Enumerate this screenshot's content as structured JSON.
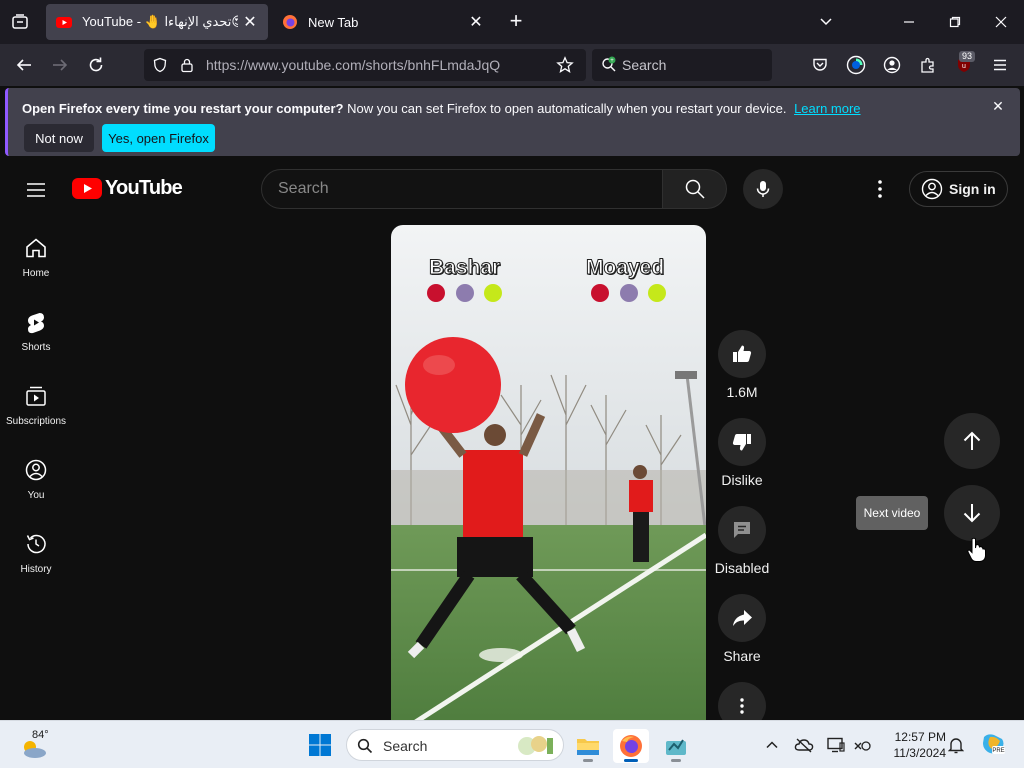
{
  "browser": {
    "tabs": [
      {
        "title": "YouTube - 🤚 تحدي الإنهاءا😍",
        "active": true
      },
      {
        "title": "New Tab",
        "active": false
      }
    ],
    "url": "https://www.youtube.com/shorts/bnhFLmdaJqQ",
    "search_placeholder": "Search",
    "extension_badge": "93"
  },
  "notification": {
    "title": "Open Firefox every time you restart your computer?",
    "body": "Now you can set Firefox to open automatically when you restart your device.",
    "link": "Learn more",
    "not_now": "Not now",
    "yes": "Yes, open Firefox"
  },
  "youtube": {
    "logo_text": "YouTube",
    "search_placeholder": "Search",
    "signin": "Sign in",
    "sidebar": [
      {
        "label": "Home",
        "icon": "home-icon"
      },
      {
        "label": "Shorts",
        "icon": "shorts-icon"
      },
      {
        "label": "Subscriptions",
        "icon": "subscriptions-icon"
      },
      {
        "label": "You",
        "icon": "you-icon"
      },
      {
        "label": "History",
        "icon": "history-icon"
      }
    ],
    "short": {
      "player1": "Bashar",
      "player2": "Moayed"
    },
    "actions": {
      "likes": "1.6M",
      "dislike": "Dislike",
      "comments": "Disabled",
      "share": "Share"
    },
    "tooltip": "Next video"
  },
  "taskbar": {
    "temperature": "84°",
    "search_placeholder": "Search",
    "time": "12:57 PM",
    "date": "11/3/2024"
  },
  "colors": {
    "youtube_red": "#ff0000",
    "firefox_accent": "#00ddff",
    "page_bg": "#0f0f0f"
  }
}
